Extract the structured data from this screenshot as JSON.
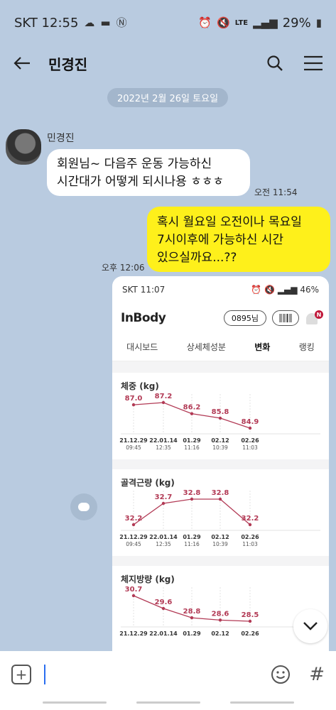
{
  "status_bar": {
    "carrier_time": "SKT 12:55",
    "lte": "LTE",
    "battery": "29%"
  },
  "header": {
    "title": "민경진"
  },
  "chat": {
    "date": "2022년 2월 26일 토요일",
    "sender": "민경진",
    "incoming_text_1": "회원님~ 다음주 운동 가능하신",
    "incoming_text_2": "시간대가 어떻게 되시나용 ㅎㅎㅎ",
    "incoming_time": "오전 11:54",
    "outgoing_text_1": "혹시 월요일 오전이나 목요일",
    "outgoing_text_2": "7시이후에 가능하신 시간",
    "outgoing_text_3": "있으실까요...??",
    "outgoing_time": "오후 12:06"
  },
  "inbody_screenshot": {
    "mini_status_left": "SKT 11:07",
    "mini_status_right": "46%",
    "logo": "InBody",
    "user_pill": "0895님",
    "notification_badge": "N",
    "tabs": [
      "대시보드",
      "상세체성분",
      "변화",
      "랭킹"
    ],
    "active_tab": "변화",
    "accent_color": "#b23a55"
  },
  "chart_data": [
    {
      "type": "line",
      "title": "체중 (kg)",
      "categories": [
        "21.12.29",
        "22.01.14",
        "01.29",
        "02.12",
        "02.26"
      ],
      "times": [
        "09:45",
        "12:35",
        "11:16",
        "10:39",
        "11:03"
      ],
      "values": [
        87.0,
        87.2,
        86.2,
        85.8,
        84.9
      ],
      "labels": [
        "87.0",
        "87.2",
        "86.2",
        "85.8",
        "84.9"
      ]
    },
    {
      "type": "line",
      "title": "골격근량 (kg)",
      "categories": [
        "21.12.29",
        "22.01.14",
        "01.29",
        "02.12",
        "02.26"
      ],
      "times": [
        "09:45",
        "12:35",
        "11:16",
        "10:39",
        "11:03"
      ],
      "values": [
        32.2,
        32.7,
        32.8,
        32.8,
        32.2
      ],
      "labels": [
        "32.2",
        "32.7",
        "32.8",
        "32.8",
        "32.2"
      ]
    },
    {
      "type": "line",
      "title": "체지방량 (kg)",
      "categories": [
        "21.12.29",
        "22.01.14",
        "01.29",
        "02.12",
        "02.26"
      ],
      "times": [],
      "values": [
        30.7,
        29.6,
        28.8,
        28.6,
        28.5
      ],
      "labels": [
        "30.7",
        "29.6",
        "28.8",
        "28.6",
        "28.5"
      ]
    }
  ],
  "input": {
    "hash_label": "#"
  }
}
